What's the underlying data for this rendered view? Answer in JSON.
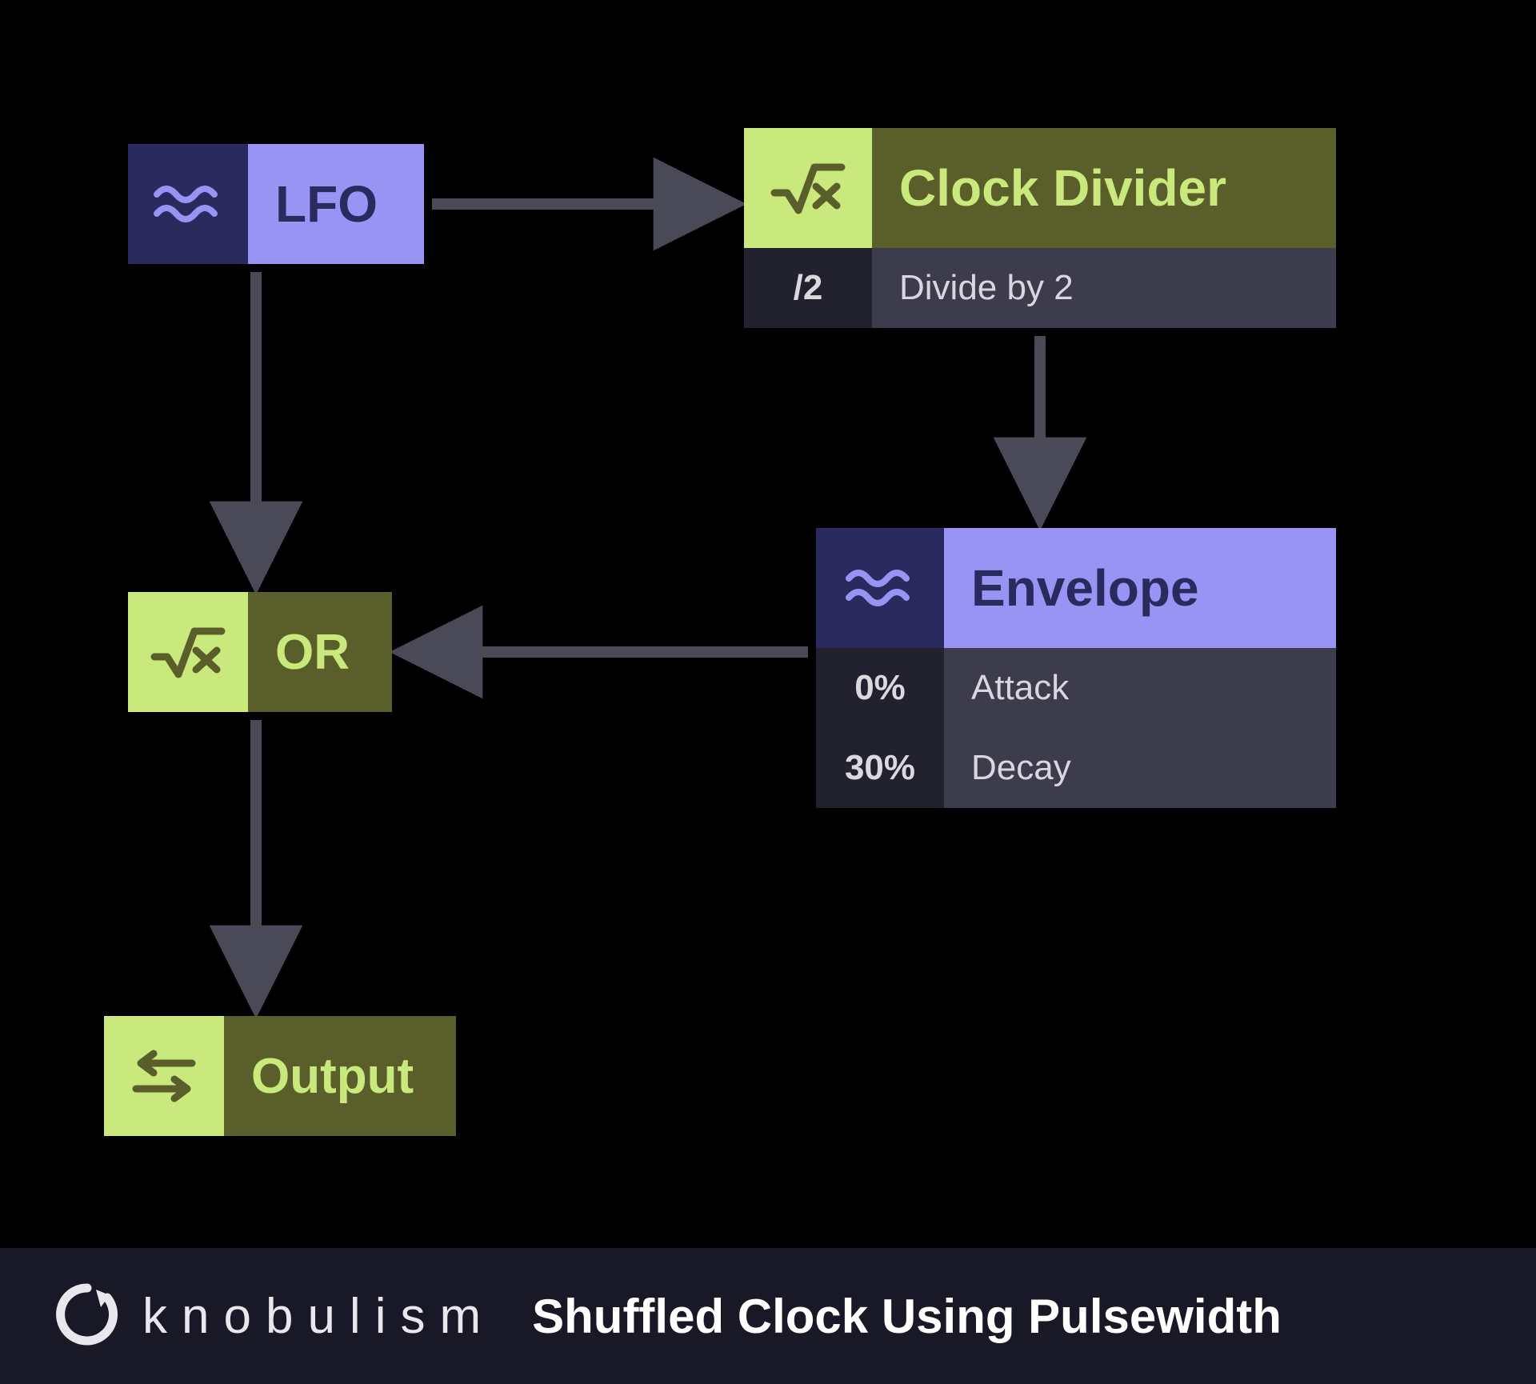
{
  "diagram": {
    "title": "Shuffled Clock Using Pulsewidth",
    "brand": "knobulism",
    "nodes": {
      "lfo": {
        "label": "LFO",
        "icon": "wave"
      },
      "clock_divider": {
        "label": "Clock Divider",
        "icon": "sqrt",
        "params": [
          {
            "key": "/2",
            "value": "Divide by 2"
          }
        ]
      },
      "envelope": {
        "label": "Envelope",
        "icon": "wave",
        "params": [
          {
            "key": "0%",
            "value": "Attack"
          },
          {
            "key": "30%",
            "value": "Decay"
          }
        ]
      },
      "or": {
        "label": "OR",
        "icon": "sqrt"
      },
      "output": {
        "label": "Output",
        "icon": "io"
      }
    },
    "edges": [
      {
        "from": "lfo",
        "to": "clock_divider"
      },
      {
        "from": "lfo",
        "to": "or"
      },
      {
        "from": "clock_divider",
        "to": "envelope"
      },
      {
        "from": "envelope",
        "to": "or"
      },
      {
        "from": "or",
        "to": "output"
      }
    ],
    "colors": {
      "lilac": "#9794f4",
      "darknavy": "#2b2a5e",
      "lime": "#c9e97c",
      "olive": "#5a5e2a",
      "arrow": "#4a4958",
      "footer_bg": "#191826"
    }
  }
}
